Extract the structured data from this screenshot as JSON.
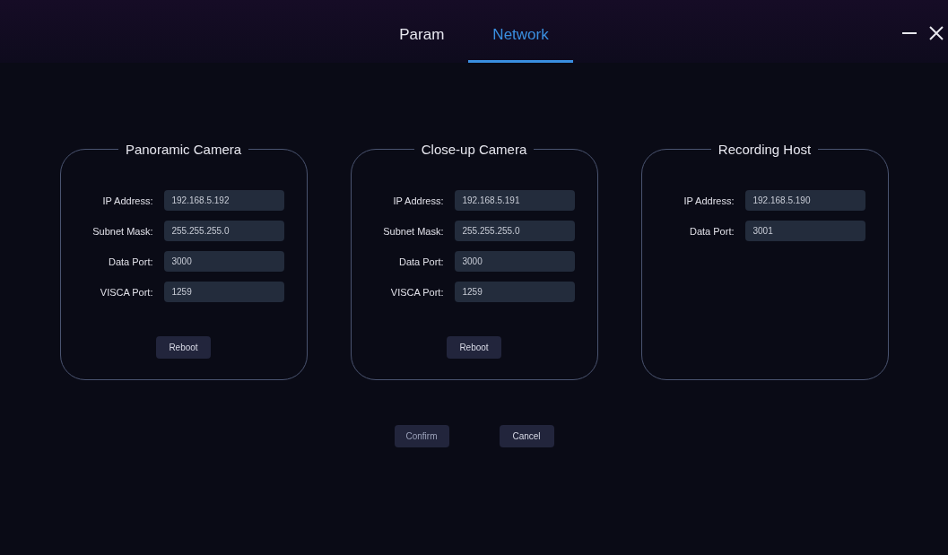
{
  "tabs": [
    {
      "label": "Param",
      "selected": false
    },
    {
      "label": "Network",
      "selected": true
    }
  ],
  "panels": [
    {
      "title": "Panoramic Camera",
      "fields": [
        {
          "label": "IP Address:",
          "value": "192.168.5.192"
        },
        {
          "label": "Subnet Mask:",
          "value": "255.255.255.0"
        },
        {
          "label": "Data Port:",
          "value": "3000"
        },
        {
          "label": "VISCA Port:",
          "value": "1259"
        }
      ],
      "button": "Reboot"
    },
    {
      "title": "Close-up Camera",
      "fields": [
        {
          "label": "IP Address:",
          "value": "192.168.5.191"
        },
        {
          "label": "Subnet Mask:",
          "value": "255.255.255.0"
        },
        {
          "label": "Data Port:",
          "value": "3000"
        },
        {
          "label": "VISCA Port:",
          "value": "1259"
        }
      ],
      "button": "Reboot"
    },
    {
      "title": "Recording Host",
      "fields": [
        {
          "label": "IP Address:",
          "value": "192.168.5.190"
        },
        {
          "label": "Data Port:",
          "value": "3001"
        }
      ]
    }
  ],
  "buttons": [
    "Confirm",
    "Cancel"
  ]
}
